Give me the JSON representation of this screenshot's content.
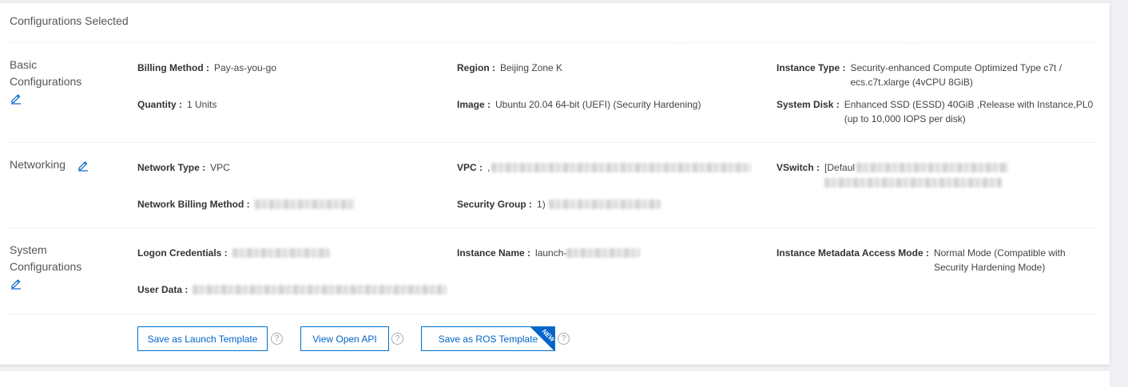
{
  "header": {
    "title": "Configurations Selected"
  },
  "sections": {
    "basic": {
      "title_line1": "Basic",
      "title_line2": "Configurations",
      "billing_method": {
        "label": "Billing Method :",
        "value": "Pay-as-you-go"
      },
      "region": {
        "label": "Region :",
        "value": "Beijing Zone K"
      },
      "instance_type": {
        "label": "Instance Type :",
        "value_line1": "Security-enhanced Compute Optimized Type c7t /",
        "value_line2": "ecs.c7t.xlarge  (4vCPU 8GiB)"
      },
      "quantity": {
        "label": "Quantity :",
        "value": "1 Units"
      },
      "image": {
        "label": "Image :",
        "value": "Ubuntu 20.04 64-bit (UEFI)  (Security Hardening)"
      },
      "system_disk": {
        "label": "System Disk :",
        "value_line1": "Enhanced SSD (ESSD) 40GiB ,Release with Instance,PL0",
        "value_line2": "(up to 10,000 IOPS per disk)"
      }
    },
    "networking": {
      "title": "Networking",
      "network_type": {
        "label": "Network Type :",
        "value": "VPC"
      },
      "vpc": {
        "label": "VPC :",
        "value": ","
      },
      "vswitch": {
        "label": "VSwitch :",
        "value": "[Defaul"
      },
      "network_billing": {
        "label": "Network Billing Method :"
      },
      "security_group": {
        "label": "Security Group :",
        "value": "1)"
      }
    },
    "system": {
      "title_line1": "System",
      "title_line2": "Configurations",
      "logon_credentials": {
        "label": "Logon Credentials :"
      },
      "instance_name": {
        "label": "Instance Name :",
        "value": "launch-"
      },
      "metadata_mode": {
        "label": "Instance Metadata Access Mode :",
        "value_line1": "Normal Mode (Compatible with",
        "value_line2": "Security Hardening Mode)"
      },
      "user_data": {
        "label": "User Data :"
      }
    }
  },
  "actions": {
    "save_launch_template": "Save as Launch Template",
    "view_open_api": "View Open API",
    "save_ros_template": "Save as ROS Template",
    "new_badge": "NEW",
    "help_glyph": "?"
  },
  "icons": {
    "edit": "edit-pencil-icon",
    "help": "question-circle-icon"
  },
  "colors": {
    "accent": "#0064c8",
    "background": "#eef0f3"
  }
}
